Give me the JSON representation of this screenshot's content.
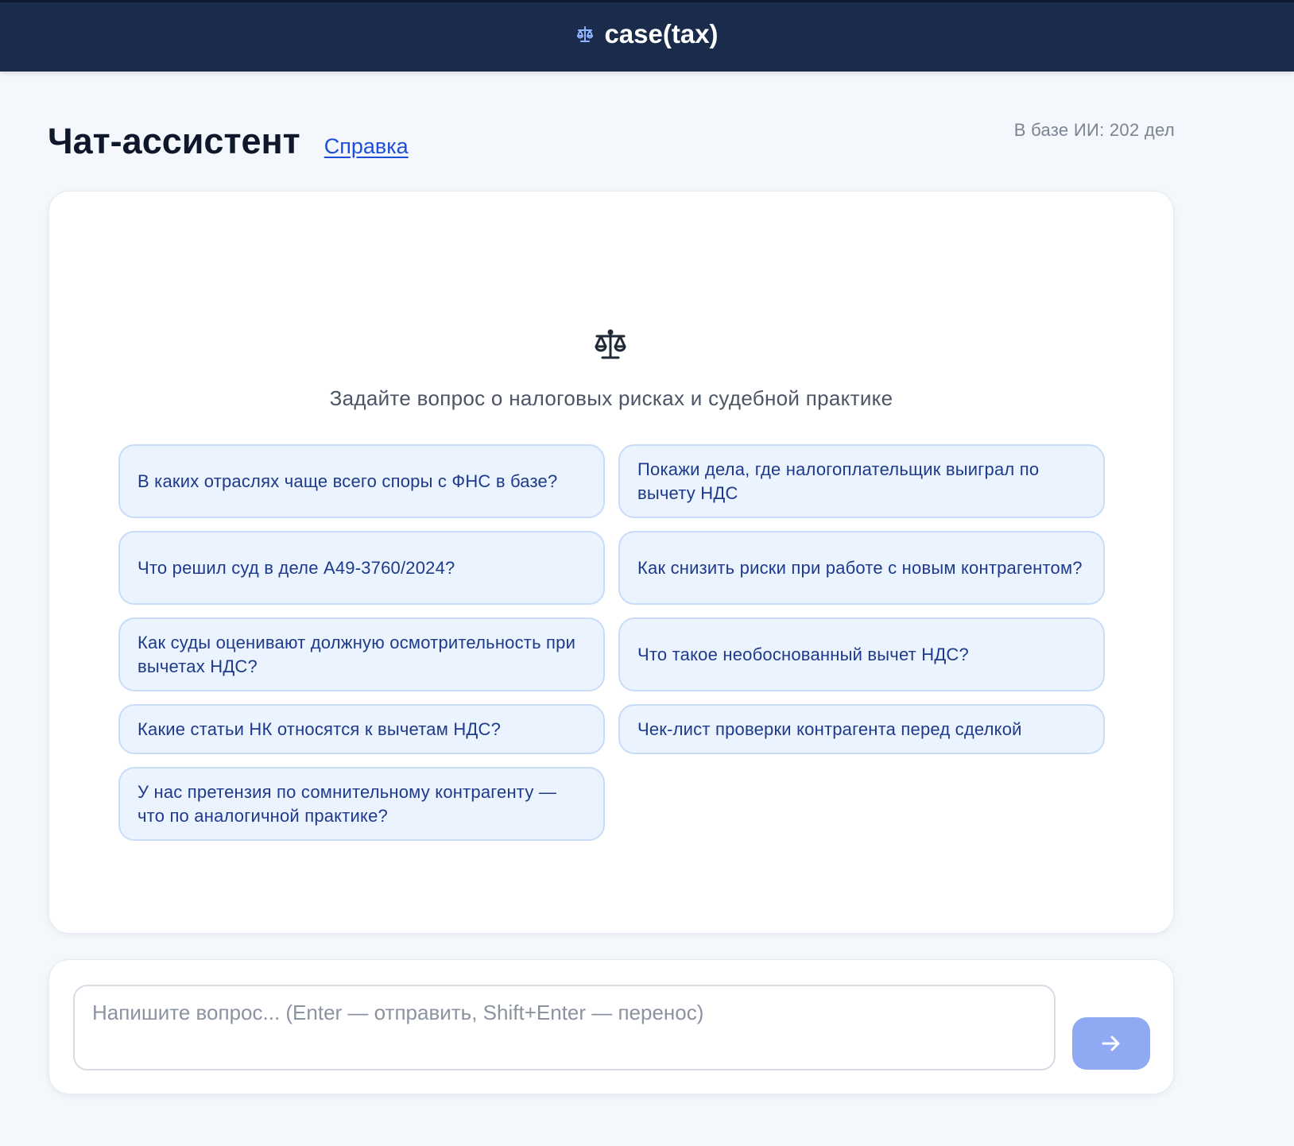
{
  "header": {
    "brand_name": "case(tax)",
    "brand_icon": "scales-icon"
  },
  "page": {
    "title": "Чат-ассистент",
    "help_link": "Справка",
    "db_count": "В базе ИИ: 202 дел"
  },
  "chat": {
    "empty_icon": "scales-icon",
    "empty_prompt": "Задайте вопрос о налоговых рисках и судебной практике",
    "suggestions": [
      "В каких отраслях чаще всего споры с ФНС в базе?",
      "Покажи дела, где налогоплательщик выиграл по вычету НДС",
      "Что решил суд в деле А49-3760/2024?",
      "Как снизить риски при работе с новым контрагентом?",
      "Как суды оценивают должную осмотрительность при вычетах НДС?",
      "Что такое необоснованный вычет НДС?",
      "Какие статьи НК относятся к вычетам НДС?",
      "Чек-лист проверки контрагента перед сделкой",
      "У нас претензия по сомнительному контрагенту — что по аналогичной практике?"
    ]
  },
  "composer": {
    "placeholder": "Напишите вопрос... (Enter — отправить, Shift+Enter — перенос)",
    "value": "",
    "send_icon": "arrow-right-icon"
  },
  "colors": {
    "header_bg": "#1a2b4c",
    "link": "#1d4ed8",
    "chip_bg": "#ebf3ff",
    "chip_border": "#c9dcf7",
    "chip_text": "#1e3a8a",
    "send_button": "#8faaf3"
  }
}
